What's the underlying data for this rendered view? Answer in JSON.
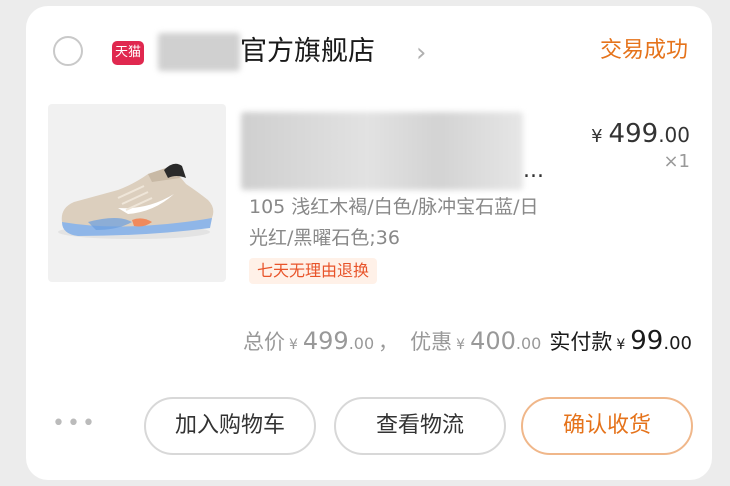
{
  "store": {
    "platform_badge": "天猫",
    "name": "官方旗舰店",
    "status": "交易成功"
  },
  "item": {
    "title_suffix": "...",
    "price_currency": "¥",
    "price_int": "499",
    "price_dec": ".00",
    "quantity": "×1",
    "sku": "105 浅红木褐/白色/脉冲宝石蓝/日光红/黑曜石色;36",
    "tag": "七天无理由退换"
  },
  "summary": {
    "total_label": "总价",
    "total_currency": "¥",
    "total_int": "499",
    "total_dec": ".00",
    "separator": "，",
    "discount_label": "优惠",
    "discount_currency": "¥",
    "discount_int": "400",
    "discount_dec": ".00",
    "paid_label": "实付款",
    "paid_currency": "¥",
    "paid_int": "99",
    "paid_dec": ".00"
  },
  "actions": {
    "more": "•••",
    "add_to_cart": "加入购物车",
    "view_logistics": "查看物流",
    "confirm_receipt": "确认收货"
  },
  "colors": {
    "accent": "#e5731b",
    "tmall_red": "#e0284f",
    "tag_bg": "#fff1e8"
  },
  "icons": {
    "select": "radio-circle",
    "store_arrow": "chevron-right",
    "product": "sneaker-image"
  }
}
